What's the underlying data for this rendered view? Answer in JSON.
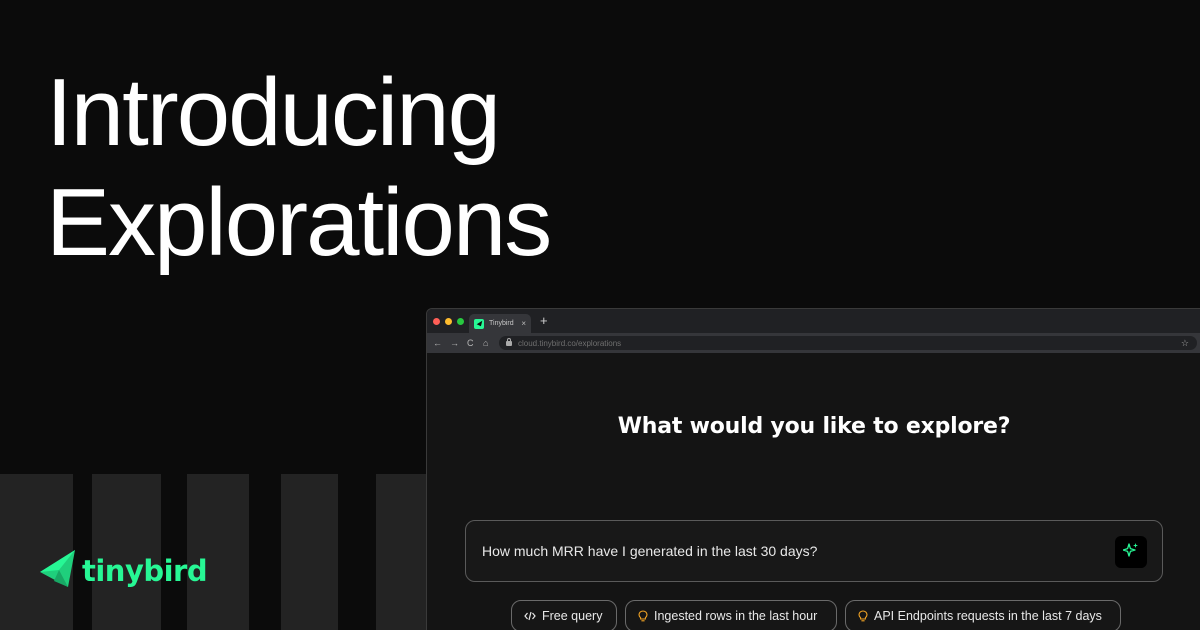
{
  "headline": {
    "line1": "Introducing",
    "line2": "Explorations"
  },
  "brand": {
    "name": "tinybird",
    "accent_color": "#27f795"
  },
  "browser": {
    "tab": {
      "title": "Tinybird",
      "close": "×"
    },
    "new_tab": "+",
    "nav": {
      "back": "←",
      "forward": "→",
      "reload": "C",
      "home": "⌂"
    },
    "address": {
      "url": "cloud.tinybird.co/explorations",
      "star": "☆"
    },
    "traffic_lights": {
      "close_color": "#ff5f57",
      "minimize_color": "#febc2e",
      "maximize_color": "#28c840"
    }
  },
  "explore": {
    "title": "What would you like to explore?",
    "query": "How much MRR have I generated in the last 30 days?",
    "suggestions": [
      {
        "label": "Free query",
        "icon": "code-icon"
      },
      {
        "label": "Ingested rows in the last hour",
        "icon": "lightbulb-icon"
      },
      {
        "label": "API Endpoints requests in the last 7 days",
        "icon": "lightbulb-icon"
      }
    ]
  }
}
